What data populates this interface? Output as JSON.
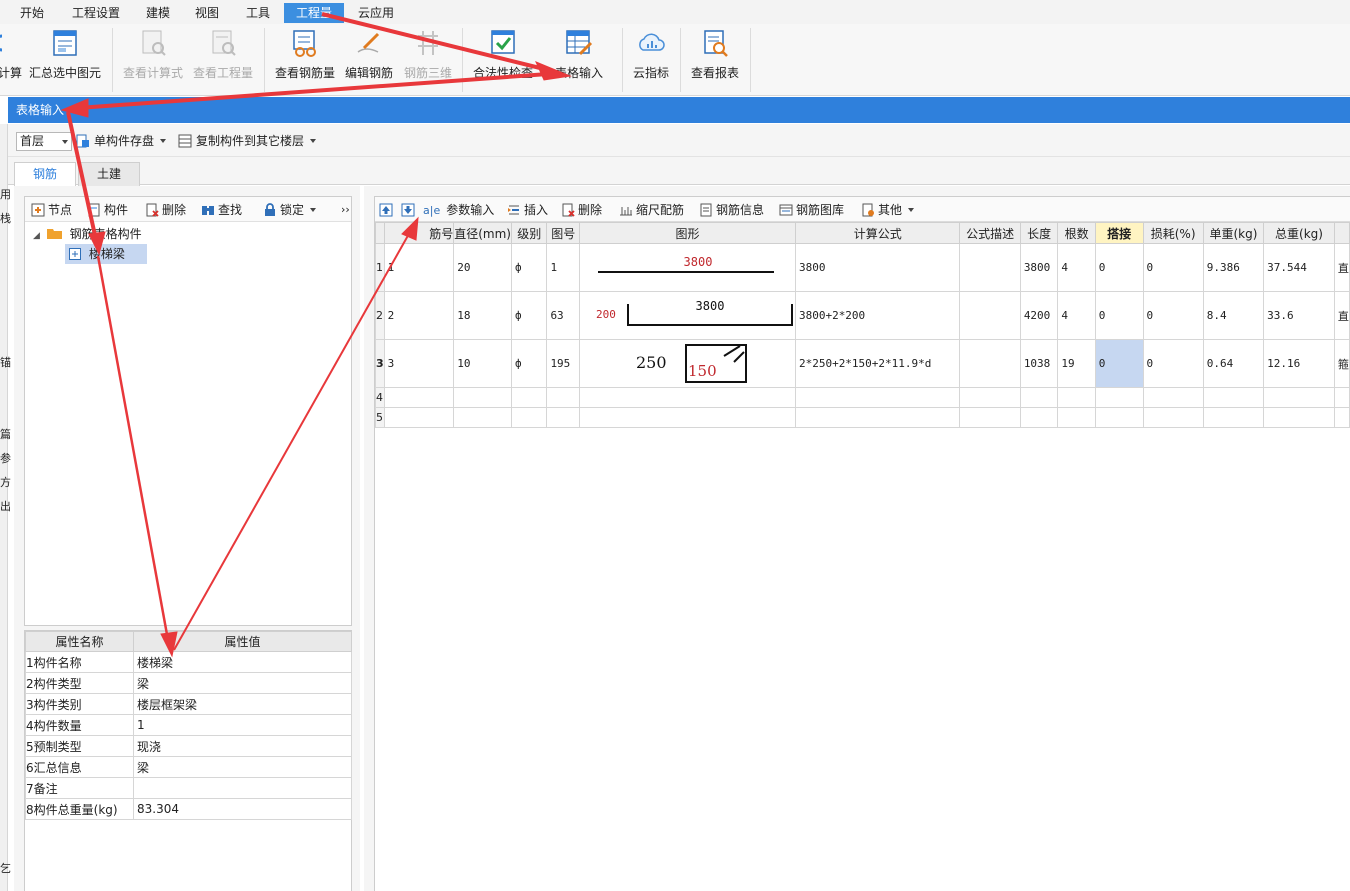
{
  "menu": {
    "items": [
      "开始",
      "工程设置",
      "建模",
      "视图",
      "工具",
      "工程量",
      "云应用"
    ],
    "active_index": 5
  },
  "ribbon": {
    "partial_left_label": "计算",
    "buttons": [
      {
        "label": "汇总选中图元",
        "icon": "summary-table-icon",
        "enabled": true
      },
      {
        "label": "查看计算式",
        "icon": "view-formula-icon",
        "enabled": false
      },
      {
        "label": "查看工程量",
        "icon": "view-quantity-icon",
        "enabled": false
      },
      {
        "label": "查看钢筋量",
        "icon": "view-rebar-icon",
        "enabled": true
      },
      {
        "label": "编辑钢筋",
        "icon": "edit-rebar-icon",
        "enabled": true
      },
      {
        "label": "钢筋三维",
        "icon": "rebar-3d-icon",
        "enabled": false
      },
      {
        "label": "合法性检查",
        "icon": "check-icon",
        "enabled": true
      },
      {
        "label": "表格输入",
        "icon": "table-input-icon",
        "enabled": true
      },
      {
        "label": "云指标",
        "icon": "cloud-index-icon",
        "enabled": true
      },
      {
        "label": "查看报表",
        "icon": "view-report-icon",
        "enabled": true
      }
    ]
  },
  "panel_title": "表格输入",
  "floorbar": {
    "floor_value": "首层",
    "save_component_label": "单构件存盘",
    "copy_component_label": "复制构件到其它楼层"
  },
  "tabs": [
    {
      "label": "钢筋",
      "active": true
    },
    {
      "label": "土建",
      "active": false
    }
  ],
  "left_strip_chars": [
    "用",
    "栈",
    "锚",
    "篇",
    "参",
    "方",
    "出",
    "乞"
  ],
  "tree": {
    "toolbar": [
      "节点",
      "构件",
      "删除",
      "查找",
      "锁定"
    ],
    "root_label": "钢筋表格构件",
    "child_label": "楼梯梁"
  },
  "properties": {
    "headers": [
      "属性名称",
      "属性值"
    ],
    "rows": [
      {
        "idx": "1",
        "name": "构件名称",
        "value": "楼梯梁"
      },
      {
        "idx": "2",
        "name": "构件类型",
        "value": "梁"
      },
      {
        "idx": "3",
        "name": "构件类别",
        "value": "楼层框架梁"
      },
      {
        "idx": "4",
        "name": "构件数量",
        "value": "1"
      },
      {
        "idx": "5",
        "name": "预制类型",
        "value": "现浇"
      },
      {
        "idx": "6",
        "name": "汇总信息",
        "value": "梁"
      },
      {
        "idx": "7",
        "name": "备注",
        "value": ""
      },
      {
        "idx": "8",
        "name": "构件总重量(kg)",
        "value": "83.304"
      }
    ]
  },
  "grid_toolbar": [
    "参数输入",
    "插入",
    "删除",
    "缩尺配筋",
    "钢筋信息",
    "钢筋图库",
    "其他"
  ],
  "grid": {
    "headers": [
      "筋号",
      "直径(mm)",
      "级别",
      "图号",
      "图形",
      "计算公式",
      "公式描述",
      "长度",
      "根数",
      "搭接",
      "损耗(%)",
      "单重(kg)",
      "总重(kg)"
    ],
    "rows": [
      {
        "rn": "1",
        "jh": "1",
        "d": "20",
        "grade": "ф",
        "fig": "1",
        "shape_a": "3800",
        "formula": "3800",
        "desc": "",
        "len": "3800",
        "count": "4",
        "lap": "0",
        "loss": "0",
        "unit_w": "9.386",
        "total_w": "37.544",
        "extra": "直"
      },
      {
        "rn": "2",
        "jh": "2",
        "d": "18",
        "grade": "ф",
        "fig": "63",
        "shape_a": "3800",
        "shape_b": "200",
        "formula": "3800+2*200",
        "desc": "",
        "len": "4200",
        "count": "4",
        "lap": "0",
        "loss": "0",
        "unit_w": "8.4",
        "total_w": "33.6",
        "extra": "直"
      },
      {
        "rn": "3",
        "jh": "3",
        "d": "10",
        "grade": "ф",
        "fig": "195",
        "shape_a": "250",
        "shape_b": "150",
        "formula": "2*250+2*150+2*11.9*d",
        "desc": "",
        "len": "1038",
        "count": "19",
        "lap": "0",
        "loss": "0",
        "unit_w": "0.64",
        "total_w": "12.16",
        "extra": "箍"
      },
      {
        "rn": "4"
      },
      {
        "rn": "5"
      }
    ]
  },
  "colors": {
    "accent": "#2f80dc",
    "menu_active": "#3c8fe0",
    "annotation_arrow": "#e8383b",
    "dim_text": "#c0282d",
    "selected_cell": "#c6d7f1"
  }
}
